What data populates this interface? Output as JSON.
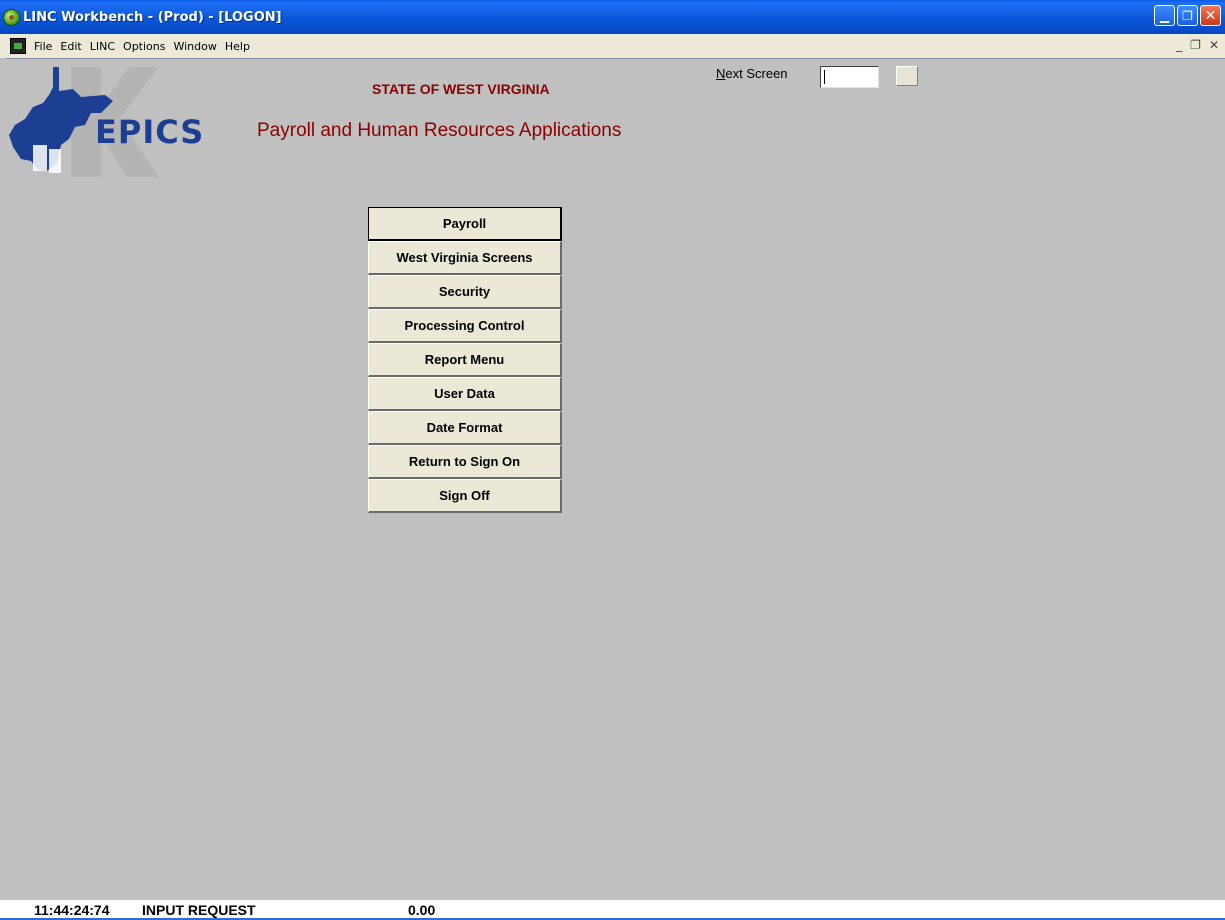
{
  "window": {
    "title": "LINC Workbench - (Prod) - [LOGON]",
    "minimize_glyph": "▁",
    "restore_glyph": "❐",
    "close_glyph": "✕"
  },
  "menubar": {
    "items": [
      "File",
      "Edit",
      "LINC",
      "Options",
      "Window",
      "Help"
    ],
    "mdi_minimize": "_",
    "mdi_restore": "❐",
    "mdi_close": "✕"
  },
  "header": {
    "logo_text": "EPICS",
    "state": "STATE OF WEST VIRGINIA",
    "app_title": "Payroll and Human Resources Applications"
  },
  "next_screen": {
    "label_accel": "N",
    "label_rest": "ext Screen",
    "value": ""
  },
  "main_menu": {
    "buttons": [
      "Payroll",
      "West Virginia Screens",
      "Security",
      "Processing Control",
      "Report Menu",
      "User Data",
      "Date Format",
      "Return to Sign On",
      "Sign Off"
    ],
    "active_index": 0
  },
  "status": {
    "time": "11:44:24:74",
    "mode": "INPUT REQUEST",
    "value": "0.00"
  },
  "colors": {
    "heading": "#8b0000",
    "logo_blue": "#1c3f94",
    "client_bg": "#c0c0c0",
    "button_face": "#ece8d8"
  }
}
